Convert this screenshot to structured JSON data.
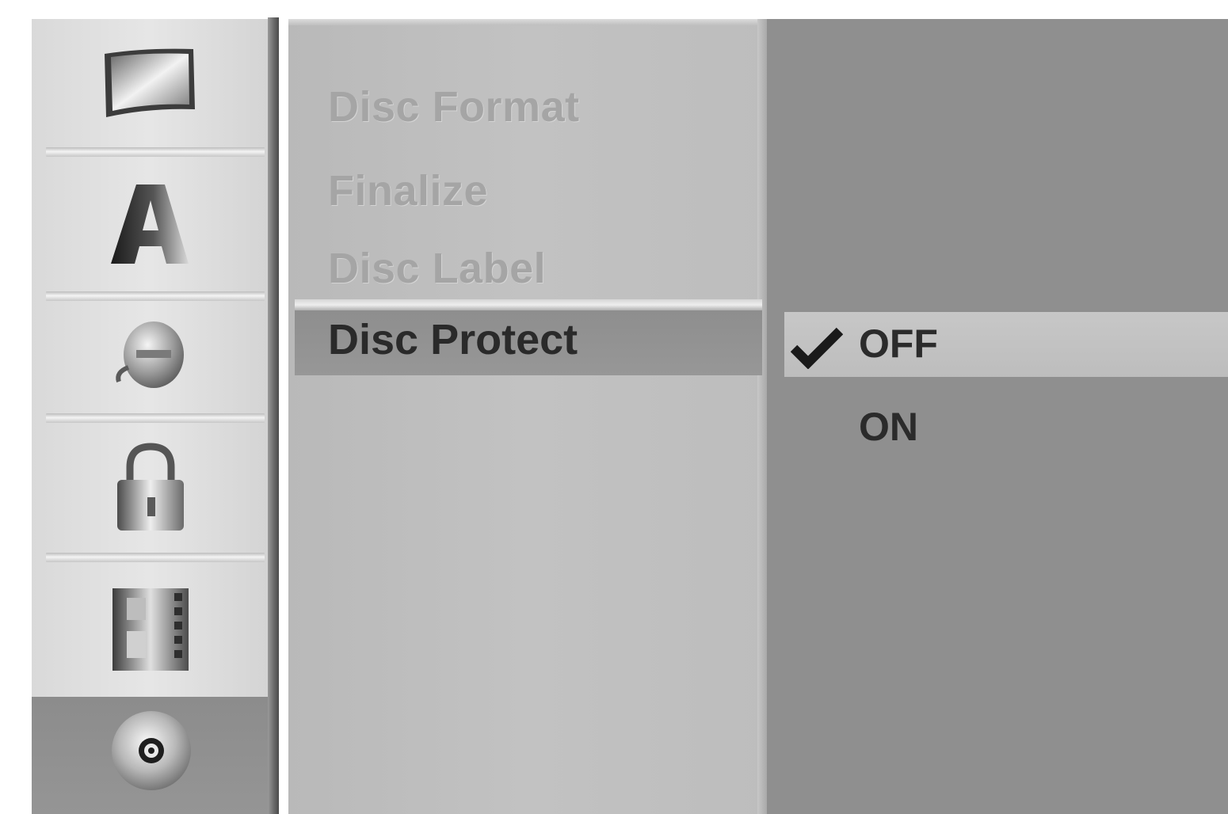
{
  "sidebar": {
    "icons": [
      {
        "name": "tv-screen-icon"
      },
      {
        "name": "audio-a-icon"
      },
      {
        "name": "language-disc-icon"
      },
      {
        "name": "lock-icon"
      },
      {
        "name": "film-icon"
      },
      {
        "name": "disc-icon",
        "selected": true
      }
    ]
  },
  "menu": {
    "items": [
      {
        "label": "Disc Format",
        "enabled": false
      },
      {
        "label": "Finalize",
        "enabled": false
      },
      {
        "label": "Disc Label",
        "enabled": false
      },
      {
        "label": "Disc Protect",
        "enabled": true,
        "selected": true
      }
    ]
  },
  "options": {
    "items": [
      {
        "label": "OFF",
        "checked": true,
        "highlighted": true
      },
      {
        "label": "ON",
        "checked": false,
        "highlighted": false
      }
    ]
  },
  "colors": {
    "sidebar_bg": "#dedede",
    "menu_bg": "#bfbfbf",
    "options_bg": "#8f8f8f",
    "selected_bg": "#939393",
    "disabled_text": "#a5a5a5",
    "active_text": "#2a2a2a"
  }
}
